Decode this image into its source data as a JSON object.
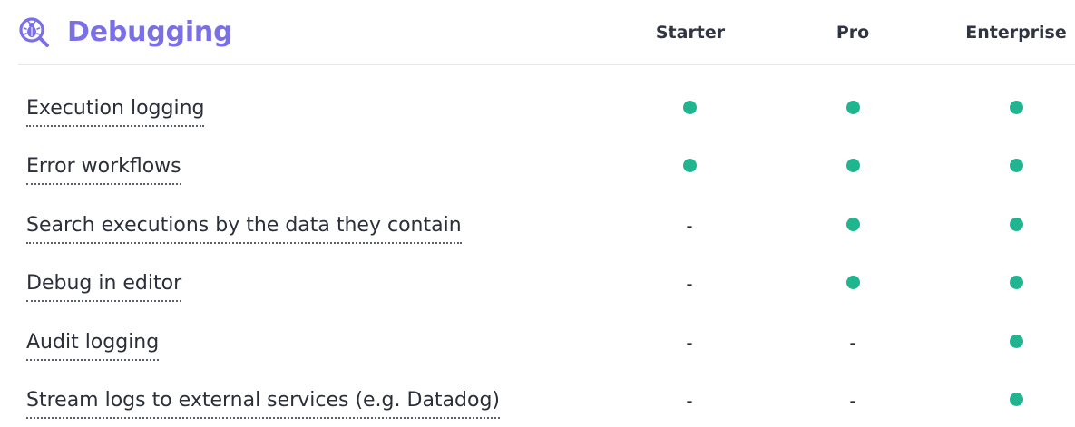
{
  "section": {
    "title": "Debugging",
    "icon": "bug-magnifier-icon",
    "accent_color": "#7a6fe6",
    "check_color": "#20b58f"
  },
  "columns": [
    "Starter",
    "Pro",
    "Enterprise"
  ],
  "rows": [
    {
      "feature": "Execution logging",
      "values": [
        "check",
        "check",
        "check"
      ],
      "marks": [
        "",
        "",
        ""
      ]
    },
    {
      "feature": "Error workflows",
      "values": [
        "check",
        "check",
        "check"
      ],
      "marks": [
        "",
        "",
        ""
      ]
    },
    {
      "feature": "Search executions by the data they contain",
      "values": [
        "none",
        "check",
        "check"
      ],
      "marks": [
        "-",
        "",
        ""
      ]
    },
    {
      "feature": "Debug in editor",
      "values": [
        "none",
        "check",
        "check"
      ],
      "marks": [
        "-",
        "",
        ""
      ]
    },
    {
      "feature": "Audit logging",
      "values": [
        "none",
        "none",
        "check"
      ],
      "marks": [
        "-",
        "-",
        ""
      ]
    },
    {
      "feature": "Stream logs to external services (e.g. Datadog)",
      "values": [
        "none",
        "none",
        "check"
      ],
      "marks": [
        "-",
        "-",
        ""
      ]
    }
  ]
}
